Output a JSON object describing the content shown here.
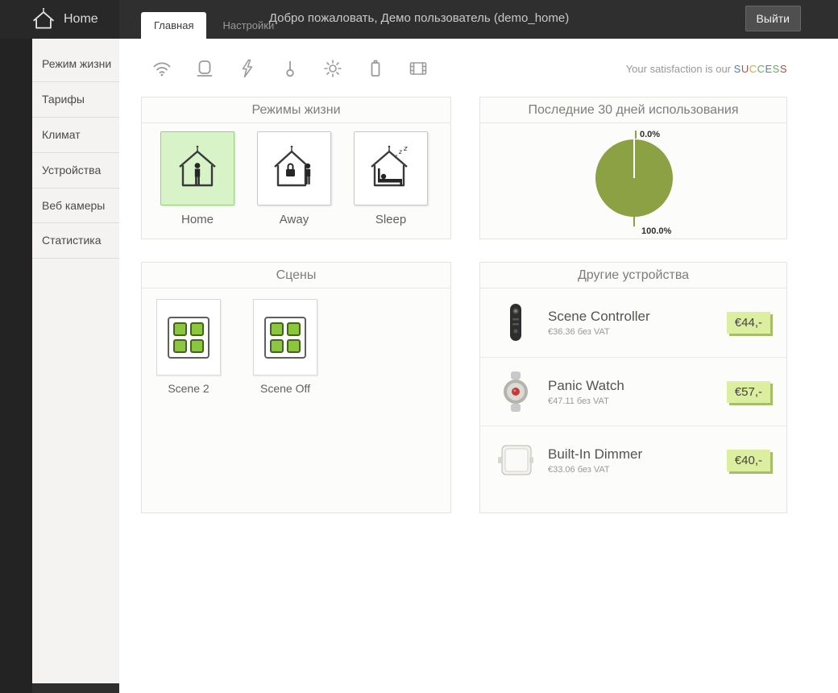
{
  "header": {
    "logo_text": "Home",
    "tabs": [
      {
        "label": "Главная",
        "active": true
      },
      {
        "label": "Настройки",
        "active": false
      }
    ],
    "welcome": "Добро пожаловать, Демо пользователь (demo_home)",
    "logout_label": "Выйти"
  },
  "sidebar": {
    "items": [
      {
        "label": "Режим жизни"
      },
      {
        "label": "Тарифы"
      },
      {
        "label": "Климат"
      },
      {
        "label": "Устройства"
      },
      {
        "label": "Веб камеры"
      },
      {
        "label": "Статистика"
      }
    ]
  },
  "toolbar": {
    "icons": [
      "wifi-icon",
      "sensor-icon",
      "lightning-icon",
      "thermometer-icon",
      "brightness-icon",
      "battery-icon",
      "video-icon"
    ],
    "tagline_prefix": "Your satisfaction is our ",
    "success_letters": [
      {
        "ch": "S",
        "color": "#4a7fd4"
      },
      {
        "ch": "U",
        "color": "#d23f3f"
      },
      {
        "ch": "C",
        "color": "#f0a030"
      },
      {
        "ch": "C",
        "color": "#58b558"
      },
      {
        "ch": "E",
        "color": "#4a7fd4"
      },
      {
        "ch": "S",
        "color": "#58b558"
      },
      {
        "ch": "S",
        "color": "#d23f3f"
      }
    ]
  },
  "panels": {
    "modes": {
      "title": "Режимы жизни",
      "items": [
        {
          "label": "Home",
          "active": true
        },
        {
          "label": "Away",
          "active": false
        },
        {
          "label": "Sleep",
          "active": false
        }
      ]
    },
    "usage": {
      "title": "Последние 30 дней использования",
      "chart_data": {
        "type": "pie",
        "labels": [
          "0.0%",
          "100.0%"
        ],
        "values": [
          0.0,
          100.0
        ],
        "colors": [
          "#fcfcfb",
          "#8ca144"
        ],
        "legend": "none"
      }
    },
    "scenes": {
      "title": "Сцены",
      "items": [
        {
          "label": "Scene 2"
        },
        {
          "label": "Scene Off"
        }
      ]
    },
    "devices": {
      "title": "Другие устройства",
      "items": [
        {
          "name": "Scene Controller",
          "vat_note": "€36.36 без VAT",
          "price": "€44,-"
        },
        {
          "name": "Panic Watch",
          "vat_note": "€47.11 без VAT",
          "price": "€57,-"
        },
        {
          "name": "Built-In Dimmer",
          "vat_note": "€33.06 без VAT",
          "price": "€40,-"
        }
      ]
    }
  }
}
